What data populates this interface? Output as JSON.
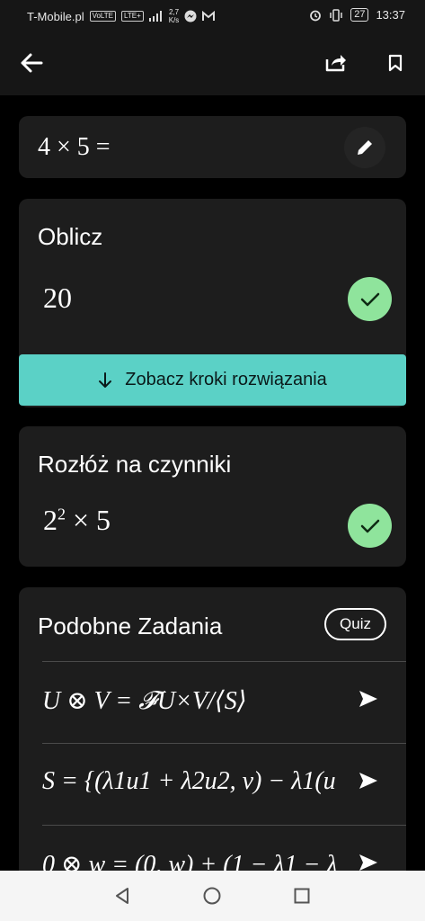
{
  "status_bar": {
    "carrier": "T-Mobile.pl",
    "volte": "VoLTE",
    "network": "LTE+",
    "speed_value": "2,7",
    "speed_unit": "K/s",
    "battery": "27",
    "time": "13:37"
  },
  "problem": {
    "expression": "4 × 5 ="
  },
  "calc_card": {
    "title": "Oblicz",
    "result": "20",
    "steps_button": "Zobacz kroki rozwiązania"
  },
  "factor_card": {
    "title": "Rozłóż na czynniki",
    "base": "2",
    "exponent": "2",
    "rest": "× 5"
  },
  "similar": {
    "title": "Podobne Zadania",
    "quiz_label": "Quiz",
    "items": [
      "U ⊗ V = 𝓕U×V/⟨S⟩",
      "S = {(λ1u1 + λ2u2, v) − λ1(u",
      "0 ⊗ w = (0, w) + (1 − λ1 − λ"
    ]
  },
  "colors": {
    "accent_teal": "#5bd1c6",
    "check_green": "#8fe49c",
    "card_bg": "#1d1d1d"
  },
  "icons": [
    "back-arrow-icon",
    "share-icon",
    "bookmark-icon",
    "pencil-icon",
    "check-icon",
    "arrow-down-icon",
    "send-icon",
    "nav-back-icon",
    "nav-home-icon",
    "nav-recents-icon"
  ]
}
